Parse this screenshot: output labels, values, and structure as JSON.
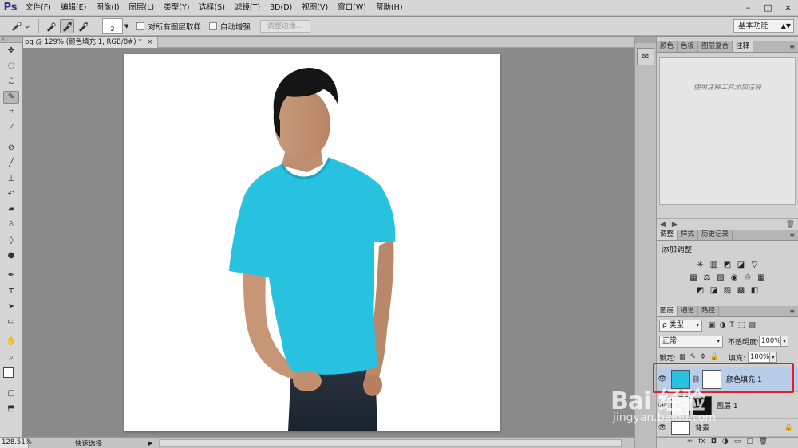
{
  "app": {
    "logo": "Ps"
  },
  "menu": [
    "文件(F)",
    "编辑(E)",
    "图像(I)",
    "图层(L)",
    "类型(Y)",
    "选择(S)",
    "滤镜(T)",
    "3D(D)",
    "视图(V)",
    "窗口(W)",
    "帮助(H)"
  ],
  "window_controls": [
    "–",
    "□",
    "×"
  ],
  "options": {
    "brush_size": "2",
    "sample_all_layers": "对所有图层取样",
    "auto_enhance": "自动增强",
    "refine_edge": "调整边缘..."
  },
  "workspace": "基本功能",
  "toolbar_header": "«",
  "tools": [
    "move-tool",
    "marquee-tool",
    "lasso-tool",
    "quick-select-tool",
    "crop-tool",
    "eyedropper-tool",
    "healing-tool",
    "brush-tool",
    "stamp-tool",
    "history-brush-tool",
    "eraser-tool",
    "paint-bucket-tool",
    "blur-tool",
    "dodge-tool",
    "pen-tool",
    "type-tool",
    "path-select-tool",
    "shape-tool",
    "hand-tool",
    "zoom-tool"
  ],
  "tool_glyphs": {
    "move": "✥",
    "marquee": "◌",
    "lasso": "ℒ",
    "quick_select": "✎",
    "crop": "⌗",
    "eyedropper": "⁄",
    "healing": "⊘",
    "brush": "╱",
    "stamp": "⊥",
    "history": "↶",
    "eraser": "▰",
    "bucket": "♙",
    "blur": "◊",
    "dodge": "●",
    "pen": "✒",
    "type": "T",
    "path_select": "➤",
    "shape": "▭",
    "hand": "✋",
    "zoom": "⌕",
    "quick_mask": "▢",
    "screen_mode": "⬒"
  },
  "document": {
    "tab_title": "pg @ 129% (颜色填充 1, RGB/8#) *",
    "close": "×"
  },
  "status": {
    "zoom": "128.51%",
    "info": "快速选择",
    "arrow": "▶"
  },
  "panels": {
    "notes": {
      "tabs": [
        "颜色",
        "色板",
        "图层复合",
        "注释"
      ],
      "active": "注释",
      "hint": "使用注释工具添加注释",
      "footer_prev": "◀",
      "footer_next": "▶",
      "footer_trash": "🗑"
    },
    "adjustments": {
      "tabs": [
        "调整",
        "样式",
        "历史记录"
      ],
      "active": "调整",
      "title": "添加调整",
      "row1": [
        "☀",
        "▥",
        "◩",
        "◪",
        "▽"
      ],
      "row2": [
        "▦",
        "⚖",
        "▧",
        "◉",
        "♲",
        "▦"
      ],
      "row3": [
        "◩",
        "◪",
        "▨",
        "▩",
        "◧"
      ]
    },
    "layers": {
      "tabs": [
        "图层",
        "通道",
        "路径"
      ],
      "active": "图层",
      "filter": "ρ 类型",
      "filter_icons": [
        "▣",
        "◑",
        "T",
        "⬚",
        "▤"
      ],
      "blend_mode": "正常",
      "opacity_label": "不透明度:",
      "opacity": "100%",
      "lock_label": "锁定:",
      "lock_icons": [
        "▦",
        "✎",
        "✥",
        "🔒"
      ],
      "fill_label": "填充:",
      "fill": "100%",
      "items": [
        {
          "name": "颜色填充 1",
          "selected": true
        },
        {
          "name": "图层 1",
          "selected": false
        },
        {
          "name": "背景",
          "selected": false
        }
      ],
      "footer_icons": [
        "∞",
        "fx",
        "◘",
        "◑",
        "▭",
        "▢",
        "🗑"
      ]
    }
  },
  "dock": {
    "notes_icon": "✉"
  },
  "watermark": {
    "brand": "Bai 经验",
    "url": "jingyan.baidu.com"
  },
  "colors": {
    "shirt": "#27c2e0",
    "selection": "#b7cde9",
    "highlight": "#e0202a",
    "ps_blue": "#2e3192"
  }
}
